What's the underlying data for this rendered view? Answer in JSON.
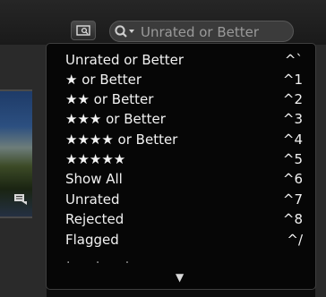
{
  "search": {
    "placeholder": "Unrated or Better"
  },
  "menu": {
    "items": [
      {
        "label": "Unrated or Better",
        "shortcut": "^`"
      },
      {
        "label": "★ or Better",
        "shortcut": "^1"
      },
      {
        "label": "★★ or Better",
        "shortcut": "^2"
      },
      {
        "label": "★★★ or Better",
        "shortcut": "^3"
      },
      {
        "label": "★★★★ or Better",
        "shortcut": "^4"
      },
      {
        "label": "★★★★★",
        "shortcut": "^5"
      },
      {
        "label": "Show All",
        "shortcut": "^6"
      },
      {
        "label": "Unrated",
        "shortcut": "^7"
      },
      {
        "label": "Rejected",
        "shortcut": "^8"
      },
      {
        "label": "Flagged",
        "shortcut": "^/"
      }
    ],
    "more_indicator": "· · ·",
    "scroll_glyph": "▼"
  },
  "icons": {
    "browser_button": "browser-view-icon",
    "search": "magnifier-dropdown-icon",
    "photo_badge": "keyword-badge-icon"
  }
}
